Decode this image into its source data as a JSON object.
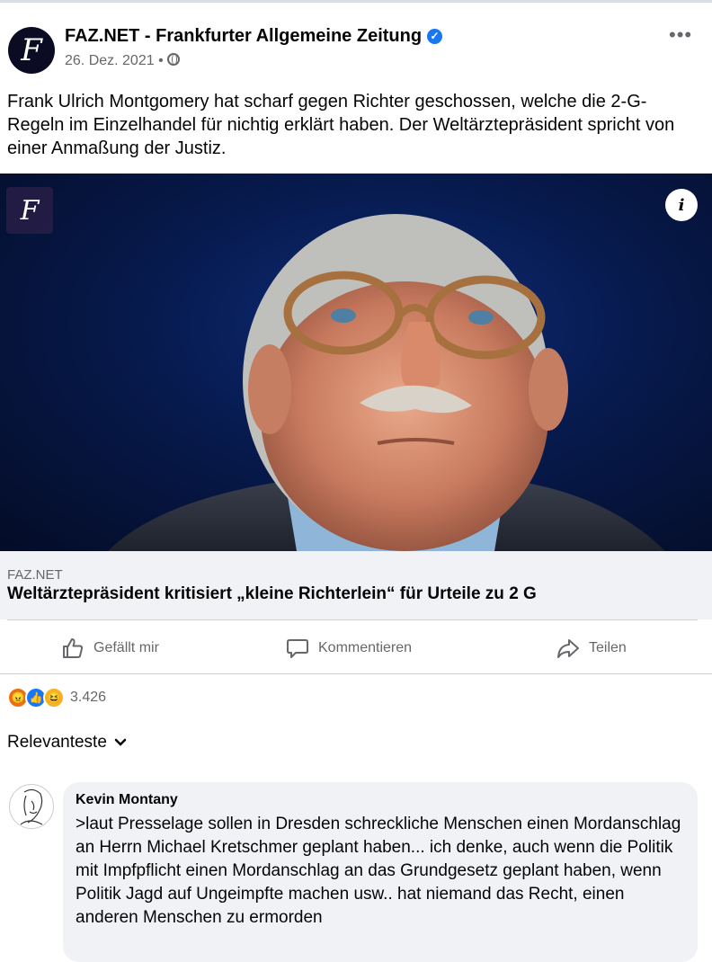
{
  "post": {
    "page_name": "FAZ.NET - Frankfurter Allgemeine Zeitung",
    "verified_icon": "verified-badge-icon",
    "date": "26. Dez. 2021",
    "separator": "•",
    "privacy_icon": "globe-icon",
    "more_icon": "more-options-icon",
    "more_glyph": "•••",
    "avatar_glyph": "F",
    "text": "Frank Ulrich Montgomery hat scharf gegen Richter geschossen, welche die 2-G-Regeln im Einzelhandel für nichtig erklärt haben. Der Weltärztepräsident spricht von einer Anmaßung der Justiz."
  },
  "link_preview": {
    "image_subject": "portrait-photo",
    "logo_glyph": "F",
    "info_glyph": "i",
    "domain": "FAZ.NET",
    "title": "Weltärztepräsident kritisiert „kleine Richterlein“ für Urteile zu 2 G"
  },
  "actions": {
    "like": "Gefällt mir",
    "comment": "Kommentieren",
    "share": "Teilen"
  },
  "reactions": {
    "icons": [
      "angry-reaction-icon",
      "like-reaction-icon",
      "haha-reaction-icon"
    ],
    "count": "3.426"
  },
  "comments_sort": {
    "label": "Relevanteste"
  },
  "comments": [
    {
      "author": "Kevin Montany",
      "text": ">laut Presselage sollen in Dresden schreckliche Menschen einen Mordanschlag an Herrn Michael Kretschmer geplant haben... ich denke, auch wenn die Politik mit Impfpflicht einen Mordanschlag an das Grundgesetz geplant haben, wenn Politik Jagd auf Ungeimpfte machen usw.. hat niemand das Recht, einen anderen Menschen zu ermorden"
    }
  ],
  "colors": {
    "accent": "#1877f2",
    "secondary_text": "#65676b",
    "preview_bg": "#f0f2f5"
  }
}
